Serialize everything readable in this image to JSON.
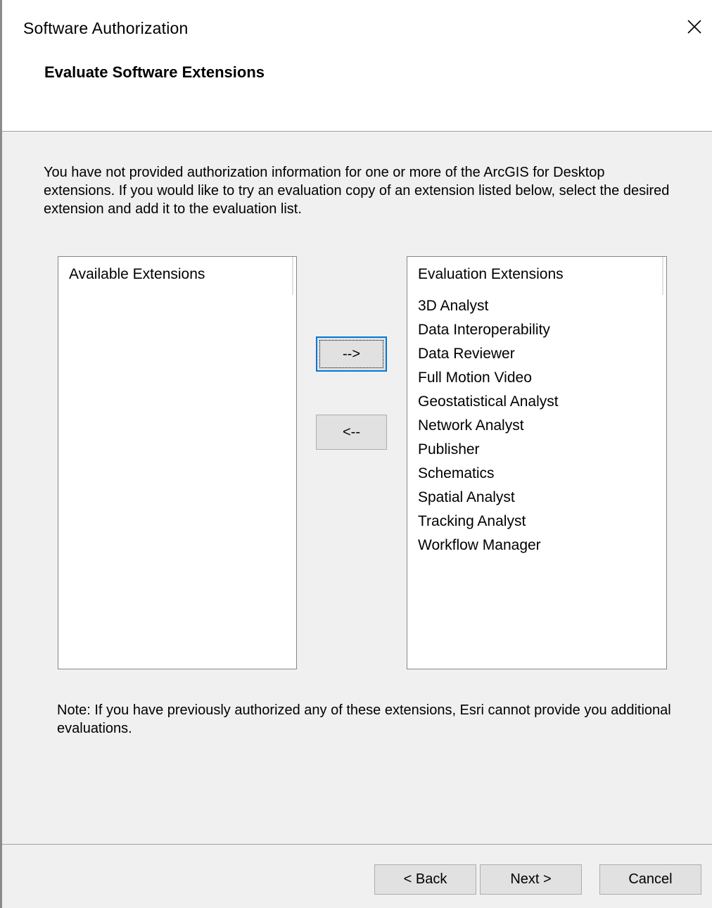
{
  "window": {
    "title": "Software Authorization",
    "close_icon": "close-icon"
  },
  "header": {
    "title": "Evaluate Software Extensions"
  },
  "intro": {
    "text": "You have not provided authorization information for one or more of the ArcGIS for Desktop extensions.  If you would like to try an evaluation copy of an extension listed below, select the desired extension and add it to the evaluation list."
  },
  "available_list": {
    "header": "Available Extensions",
    "items": []
  },
  "evaluation_list": {
    "header": "Evaluation Extensions",
    "items": [
      "3D Analyst",
      "Data Interoperability",
      "Data Reviewer",
      "Full Motion Video",
      "Geostatistical Analyst",
      "Network Analyst",
      "Publisher",
      "Schematics",
      "Spatial Analyst",
      "Tracking Analyst",
      "Workflow Manager"
    ]
  },
  "transfer": {
    "add_label": "-->",
    "remove_label": "<--"
  },
  "note": {
    "text": "Note:  If you have previously authorized any of these extensions, Esri cannot provide you additional evaluations."
  },
  "footer": {
    "back_label": "< Back",
    "next_label": "Next >",
    "cancel_label": "Cancel"
  },
  "colors": {
    "focus_border": "#0078d7",
    "dialog_background": "#f0f0f0",
    "button_face": "#e1e1e1"
  }
}
